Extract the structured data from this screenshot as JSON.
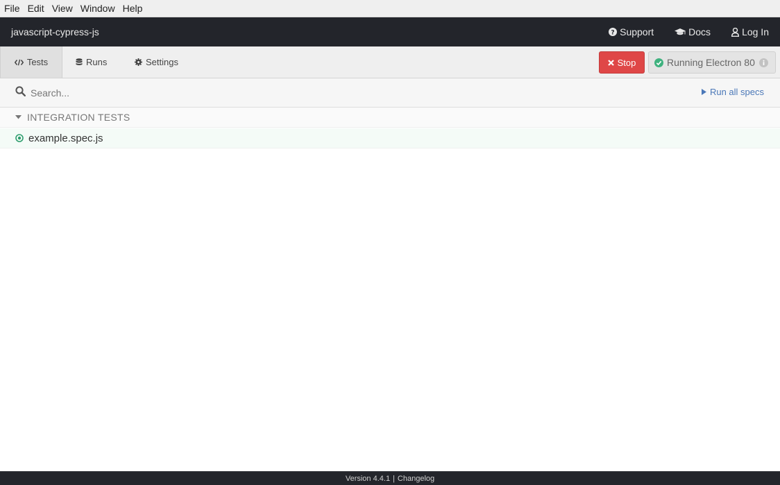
{
  "menubar": {
    "items": [
      "File",
      "Edit",
      "View",
      "Window",
      "Help"
    ]
  },
  "header": {
    "project_name": "javascript-cypress-js",
    "links": {
      "support": "Support",
      "docs": "Docs",
      "login": "Log In"
    }
  },
  "nav": {
    "tabs": {
      "tests": "Tests",
      "runs": "Runs",
      "settings": "Settings"
    },
    "active_tab": "Tests",
    "stop_label": "Stop",
    "browser_status": "Running Electron 80"
  },
  "search": {
    "placeholder": "Search...",
    "value": "",
    "run_all_label": "Run all specs"
  },
  "specs": {
    "folder_label": "INTEGRATION TESTS",
    "files": [
      "example.spec.js"
    ]
  },
  "footer": {
    "version": "Version 4.4.1",
    "separator": "|",
    "changelog": "Changelog"
  },
  "colors": {
    "header_bg": "#23252b",
    "stop_red": "#df4747",
    "running_green": "#3fb27f",
    "link_blue": "#4b78b8"
  }
}
